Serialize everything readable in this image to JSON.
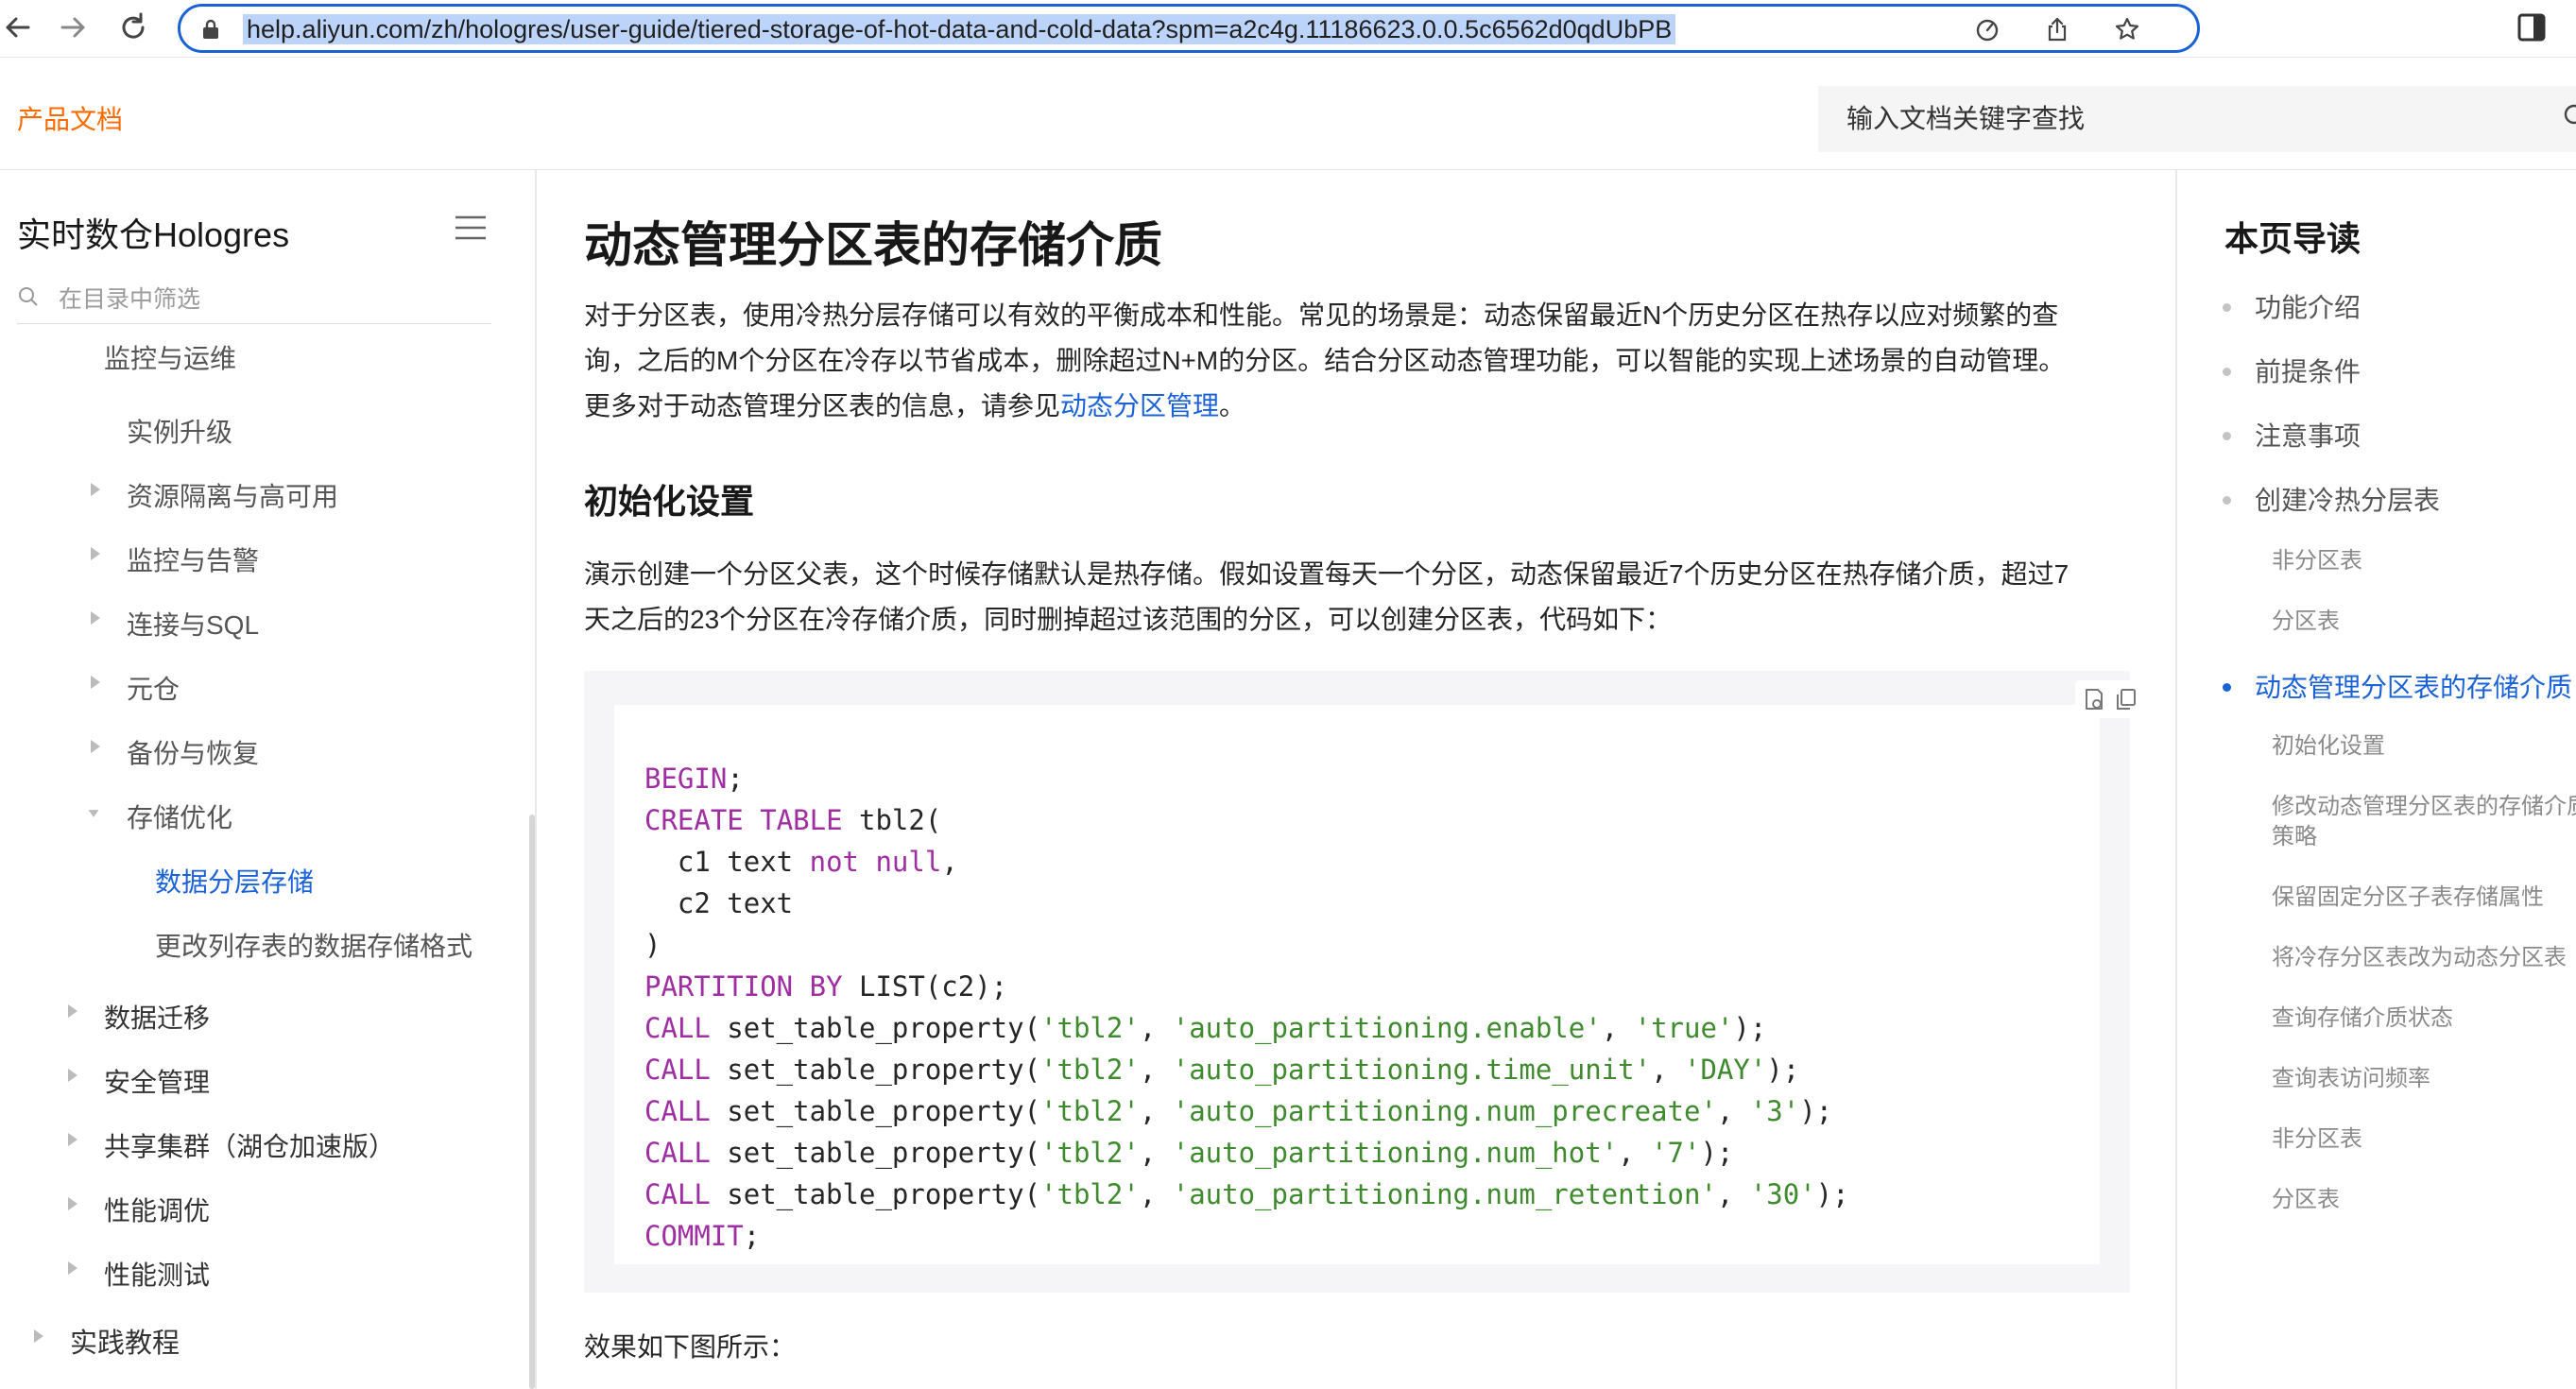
{
  "browser": {
    "url": "help.aliyun.com/zh/hologres/user-guide/tiered-storage-of-hot-data-and-cold-data?spm=a2c4g.11186623.0.0.5c6562d0qdUbPB",
    "icons": [
      "back-arrow-icon",
      "forward-arrow-icon",
      "reload-icon",
      "lock-icon",
      "performance-icon",
      "share-icon",
      "bookmark-star-icon",
      "side-panel-icon"
    ]
  },
  "header": {
    "product_docs": "产品文档",
    "search_placeholder": "输入文档关键字查找"
  },
  "sidebar": {
    "title": "实时数仓Hologres",
    "filter_placeholder": "在目录中筛选",
    "partial_item": "监控与运维",
    "items": [
      {
        "label": "实例升级",
        "expandable": false
      },
      {
        "label": "资源隔离与高可用",
        "expandable": true
      },
      {
        "label": "监控与告警",
        "expandable": true
      },
      {
        "label": "连接与SQL",
        "expandable": true
      },
      {
        "label": "元仓",
        "expandable": true
      },
      {
        "label": "备份与恢复",
        "expandable": true
      },
      {
        "label": "存储优化",
        "expandable": true,
        "expanded": true
      },
      {
        "label": "数据分层存储",
        "active": true
      },
      {
        "label": "更改列存表的数据存储格式"
      },
      {
        "label": "数据迁移",
        "expandable": true
      },
      {
        "label": "安全管理",
        "expandable": true
      },
      {
        "label": "共享集群（湖仓加速版）",
        "expandable": true
      },
      {
        "label": "性能调优",
        "expandable": true
      },
      {
        "label": "性能测试",
        "expandable": true
      },
      {
        "label": "实践教程",
        "expandable": true
      }
    ]
  },
  "main": {
    "title": "动态管理分区表的存储介质",
    "intro_line1": "对于分区表，使用冷热分层存储可以有效的平衡成本和性能。常见的场景是：动态保留最近N个历史分区在热存以应对频繁的查",
    "intro_line2": "询，之后的M个分区在冷存以节省成本，删除超过N+M的分区。结合分区动态管理功能，可以智能的实现上述场景的自动管理。",
    "intro_line3_prefix": "更多对于动态管理分区表的信息，请参见",
    "intro_link": "动态分区管理",
    "intro_line3_suffix": "。",
    "section_heading": "初始化设置",
    "setup_line1": "演示创建一个分区父表，这个时候存储默认是热存储。假如设置每天一个分区，动态保留最近7个历史分区在热存储介质，超过7",
    "setup_line2": "天之后的23个分区在冷存储介质，同时删掉超过该范围的分区，可以创建分区表，代码如下：",
    "code": {
      "l1_kw": "BEGIN",
      "l1_rest": ";",
      "l2_kw1": "CREATE",
      "l2_kw2": "TABLE",
      "l2_rest": " tbl2(",
      "l3_pre": "  c1 text ",
      "l3_kw1": "not",
      "l3_kw2": "null",
      "l3_post": ",",
      "l4": "  c2 text",
      "l5": ")",
      "l6_kw1": "PARTITION",
      "l6_kw2": "BY",
      "l6_rest": " LIST(c2);",
      "call_kw": "CALL",
      "call_fn": " set_table_property(",
      "table_str": "'tbl2'",
      "calls": [
        {
          "prop": "'auto_partitioning.enable'",
          "value": "'true'"
        },
        {
          "prop": "'auto_partitioning.time_unit'",
          "value": "'DAY'"
        },
        {
          "prop": "'auto_partitioning.num_precreate'",
          "value": "'3'"
        },
        {
          "prop": "'auto_partitioning.num_hot'",
          "value": "'7'"
        },
        {
          "prop": "'auto_partitioning.num_retention'",
          "value": "'30'"
        }
      ],
      "last_kw": "COMMIT",
      "last_rest": ";"
    },
    "result_text": "效果如下图所示："
  },
  "toc": {
    "title": "本页导读",
    "items": [
      {
        "label": "功能介绍",
        "level": 1
      },
      {
        "label": "前提条件",
        "level": 1
      },
      {
        "label": "注意事项",
        "level": 1
      },
      {
        "label": "创建冷热分层表",
        "level": 1
      },
      {
        "label": "非分区表",
        "level": 2
      },
      {
        "label": "分区表",
        "level": 2
      },
      {
        "label": "动态管理分区表的存储介质",
        "level": 1,
        "active": true
      },
      {
        "label": "初始化设置",
        "level": 2
      },
      {
        "label": "修改动态管理分区表的存储介质",
        "label2": "策略",
        "level": 2
      },
      {
        "label": "保留固定分区子表存储属性",
        "level": 2
      },
      {
        "label": "将冷存分区表改为动态分区表",
        "level": 2
      },
      {
        "label": "查询存储介质状态",
        "level": 2
      },
      {
        "label": "查询表访问频率",
        "level": 2
      },
      {
        "label": "非分区表",
        "level": 2
      },
      {
        "label": "分区表",
        "level": 2
      }
    ]
  },
  "colors": {
    "accent": "#1a62d6",
    "brand_orange": "#ff6a00",
    "code_keyword": "#9f2ea2",
    "code_string": "#3f8a2e"
  }
}
